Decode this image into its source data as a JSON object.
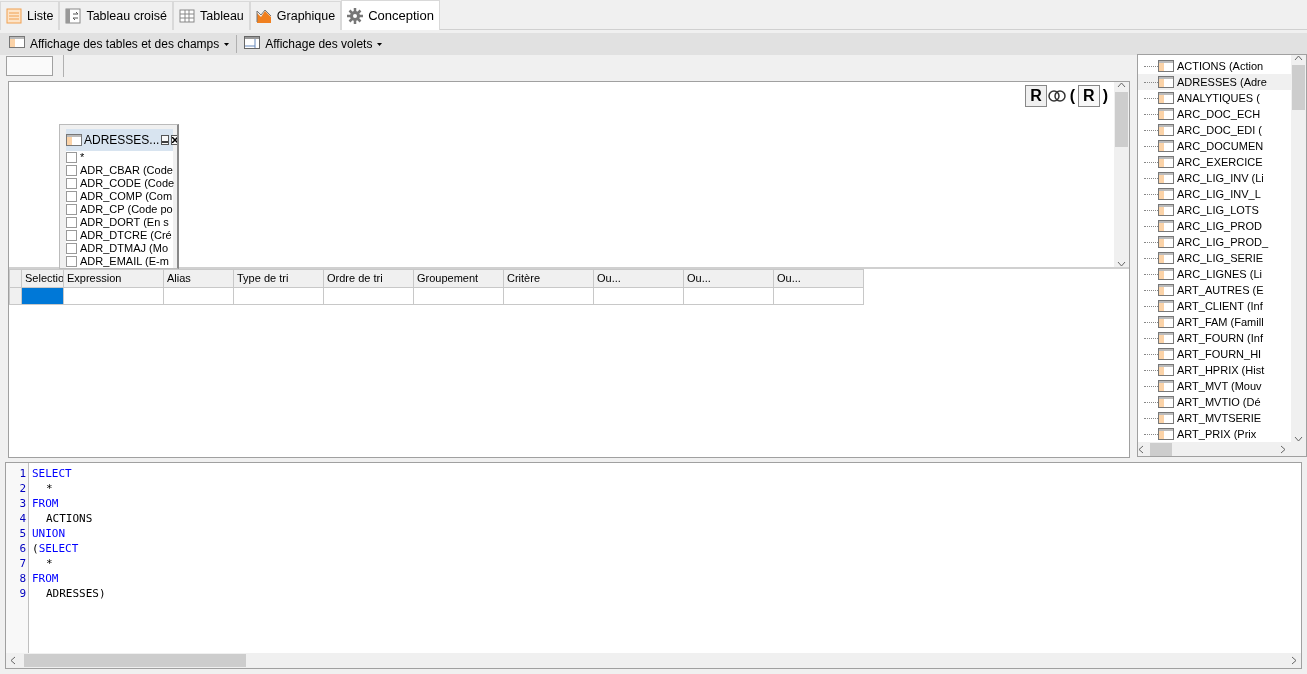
{
  "tabs": [
    {
      "label": "Liste",
      "kind": "list",
      "selected": false
    },
    {
      "label": "Tableau croisé",
      "kind": "pivot",
      "selected": false
    },
    {
      "label": "Tableau",
      "kind": "grid",
      "selected": false
    },
    {
      "label": "Graphique",
      "kind": "chart",
      "selected": false
    },
    {
      "label": "Conception",
      "kind": "gear",
      "selected": true
    }
  ],
  "toolbar": [
    {
      "label": "Affichage des tables et des champs",
      "kind": "table"
    },
    {
      "label": "Affichage des volets",
      "kind": "panes"
    }
  ],
  "join_bar": {
    "left": "R",
    "open": "(",
    "inner": "R",
    "close": ")"
  },
  "table_window": {
    "title": "ADRESSES...",
    "fields": [
      {
        "label": "*",
        "checked": false
      },
      {
        "label": "ADR_CBAR (Code",
        "checked": false
      },
      {
        "label": "ADR_CODE (Code",
        "checked": false
      },
      {
        "label": "ADR_COMP (Com",
        "checked": false
      },
      {
        "label": "ADR_CP (Code po",
        "checked": false
      },
      {
        "label": "ADR_DORT (En s",
        "checked": false
      },
      {
        "label": "ADR_DTCRE (Cré",
        "checked": false
      },
      {
        "label": "ADR_DTMAJ (Mo",
        "checked": false
      },
      {
        "label": "ADR_EMAIL (E-m",
        "checked": false
      }
    ]
  },
  "grid": {
    "columns": [
      "Selectio",
      "Expression",
      "Alias",
      "Type de tri",
      "Ordre de tri",
      "Groupement",
      "Critère",
      "Ou...",
      "Ou...",
      "Ou..."
    ],
    "rows": [
      {
        "cells": [
          {
            "selected": true
          },
          {
            "selected": false
          },
          {
            "selected": false
          },
          {
            "selected": false
          },
          {
            "selected": false
          },
          {
            "selected": false
          },
          {
            "selected": false
          },
          {
            "selected": false
          },
          {
            "selected": false
          },
          {
            "selected": false
          }
        ]
      }
    ]
  },
  "tree": {
    "items": [
      {
        "label": "ACTIONS (Action",
        "selected": false
      },
      {
        "label": "ADRESSES (Adre",
        "selected": true
      },
      {
        "label": "ANALYTIQUES (",
        "selected": false
      },
      {
        "label": "ARC_DOC_ECH",
        "selected": false
      },
      {
        "label": "ARC_DOC_EDI (",
        "selected": false
      },
      {
        "label": "ARC_DOCUMEN",
        "selected": false
      },
      {
        "label": "ARC_EXERCICE",
        "selected": false
      },
      {
        "label": "ARC_LIG_INV (Li",
        "selected": false
      },
      {
        "label": "ARC_LIG_INV_L",
        "selected": false
      },
      {
        "label": "ARC_LIG_LOTS",
        "selected": false
      },
      {
        "label": "ARC_LIG_PROD",
        "selected": false
      },
      {
        "label": "ARC_LIG_PROD_",
        "selected": false
      },
      {
        "label": "ARC_LIG_SERIE",
        "selected": false
      },
      {
        "label": "ARC_LIGNES (Li",
        "selected": false
      },
      {
        "label": "ART_AUTRES (E",
        "selected": false
      },
      {
        "label": "ART_CLIENT (Inf",
        "selected": false
      },
      {
        "label": "ART_FAM (Famill",
        "selected": false
      },
      {
        "label": "ART_FOURN (Inf",
        "selected": false
      },
      {
        "label": "ART_FOURN_HI",
        "selected": false
      },
      {
        "label": "ART_HPRIX (Hist",
        "selected": false
      },
      {
        "label": "ART_MVT (Mouv",
        "selected": false
      },
      {
        "label": "ART_MVTIO (Dé",
        "selected": false
      },
      {
        "label": "ART_MVTSERIE",
        "selected": false
      },
      {
        "label": "ART_PRIX (Prix",
        "selected": false
      }
    ]
  },
  "sql": [
    {
      "number": "1",
      "indent": false,
      "parts": [
        {
          "kind": "keyword",
          "text": "SELECT"
        }
      ]
    },
    {
      "number": "2",
      "indent": true,
      "parts": [
        {
          "kind": "plain",
          "text": "*"
        }
      ]
    },
    {
      "number": "3",
      "indent": false,
      "parts": [
        {
          "kind": "keyword",
          "text": "FROM"
        }
      ]
    },
    {
      "number": "4",
      "indent": true,
      "parts": [
        {
          "kind": "plain",
          "text": "ACTIONS"
        }
      ]
    },
    {
      "number": "5",
      "indent": false,
      "parts": [
        {
          "kind": "keyword",
          "text": "UNION"
        }
      ]
    },
    {
      "number": "6",
      "indent": false,
      "parts": [
        {
          "kind": "plain",
          "text": "("
        },
        {
          "kind": "keyword",
          "text": "SELECT"
        }
      ]
    },
    {
      "number": "7",
      "indent": true,
      "parts": [
        {
          "kind": "plain",
          "text": "*"
        }
      ]
    },
    {
      "number": "8",
      "indent": false,
      "parts": [
        {
          "kind": "keyword",
          "text": "FROM"
        }
      ]
    },
    {
      "number": "9",
      "indent": true,
      "parts": [
        {
          "kind": "plain",
          "text": "ADRESSES)"
        }
      ]
    }
  ]
}
